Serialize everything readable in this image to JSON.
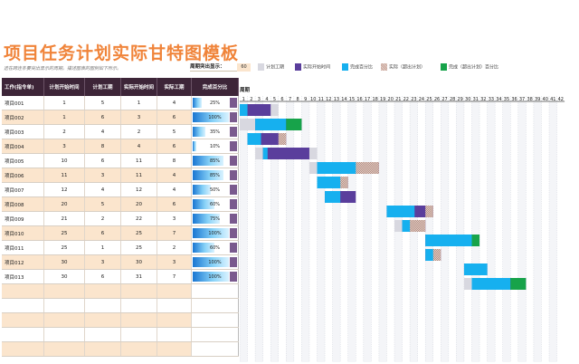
{
  "title": "项目任务计划实际甘特图模板",
  "subtitle": "选在跨连条要突出显示的周期。描述图表的图例如下所示。",
  "period_highlight": {
    "label": "周期突出显示：",
    "value": "60"
  },
  "legend": [
    {
      "label": "计划工期",
      "color": "#d8d8e0"
    },
    {
      "label": "实际开始时间",
      "color": "#5a3e9c"
    },
    {
      "label": "完成百分比",
      "color": "#16b0ef"
    },
    {
      "label": "实际（超出计划）",
      "color": "#c9a79c"
    },
    {
      "label": "完成（超出计划）百分比",
      "color": "#17a34a"
    }
  ],
  "table": {
    "headers": [
      "工作(指令单)",
      "计划开始时间",
      "计划工期",
      "实际开始时间",
      "实际工期",
      "完成百分比"
    ],
    "rows": [
      {
        "name": "项目001",
        "plan_start": 1,
        "plan_dur": 5,
        "act_start": 1,
        "act_dur": 4,
        "pct": 0.25,
        "pct_label": "25%"
      },
      {
        "name": "项目002",
        "plan_start": 1,
        "plan_dur": 6,
        "act_start": 3,
        "act_dur": 6,
        "pct": 1.0,
        "pct_label": "100%"
      },
      {
        "name": "项目003",
        "plan_start": 2,
        "plan_dur": 4,
        "act_start": 2,
        "act_dur": 5,
        "pct": 0.35,
        "pct_label": "35%"
      },
      {
        "name": "项目004",
        "plan_start": 3,
        "plan_dur": 8,
        "act_start": 4,
        "act_dur": 6,
        "pct": 0.1,
        "pct_label": "10%"
      },
      {
        "name": "项目005",
        "plan_start": 10,
        "plan_dur": 6,
        "act_start": 11,
        "act_dur": 8,
        "pct": 0.85,
        "pct_label": "85%"
      },
      {
        "name": "项目006",
        "plan_start": 11,
        "plan_dur": 3,
        "act_start": 11,
        "act_dur": 4,
        "pct": 0.85,
        "pct_label": "85%"
      },
      {
        "name": "项目007",
        "plan_start": 12,
        "plan_dur": 4,
        "act_start": 12,
        "act_dur": 4,
        "pct": 0.5,
        "pct_label": "50%"
      },
      {
        "name": "项目008",
        "plan_start": 20,
        "plan_dur": 5,
        "act_start": 20,
        "act_dur": 6,
        "pct": 0.6,
        "pct_label": "60%"
      },
      {
        "name": "项目009",
        "plan_start": 21,
        "plan_dur": 2,
        "act_start": 22,
        "act_dur": 3,
        "pct": 0.75,
        "pct_label": "75%"
      },
      {
        "name": "项目010",
        "plan_start": 25,
        "plan_dur": 6,
        "act_start": 25,
        "act_dur": 7,
        "pct": 1.0,
        "pct_label": "100%"
      },
      {
        "name": "项目011",
        "plan_start": 25,
        "plan_dur": 1,
        "act_start": 25,
        "act_dur": 2,
        "pct": 0.6,
        "pct_label": "60%"
      },
      {
        "name": "项目012",
        "plan_start": 30,
        "plan_dur": 3,
        "act_start": 30,
        "act_dur": 3,
        "pct": 1.0,
        "pct_label": "100%"
      },
      {
        "name": "项目013",
        "plan_start": 30,
        "plan_dur": 6,
        "act_start": 31,
        "act_dur": 7,
        "pct": 1.0,
        "pct_label": "100%"
      }
    ],
    "empty_rows": 5
  },
  "gantt": {
    "period_label": "周期",
    "periods": [
      1,
      2,
      3,
      4,
      5,
      6,
      7,
      8,
      9,
      10,
      11,
      12,
      13,
      14,
      15,
      16,
      17,
      18,
      19,
      20,
      21,
      22,
      23,
      24,
      25,
      26,
      27,
      28,
      29,
      30,
      31,
      32,
      33,
      34,
      35,
      36,
      37,
      38,
      39,
      40,
      41,
      42
    ],
    "colors": {
      "plan": "#d8d8e0",
      "actual": "#5a3e9c",
      "complete": "#16b0ef",
      "over_actual": "#c9a79c",
      "over_complete": "#17a34a"
    }
  }
}
